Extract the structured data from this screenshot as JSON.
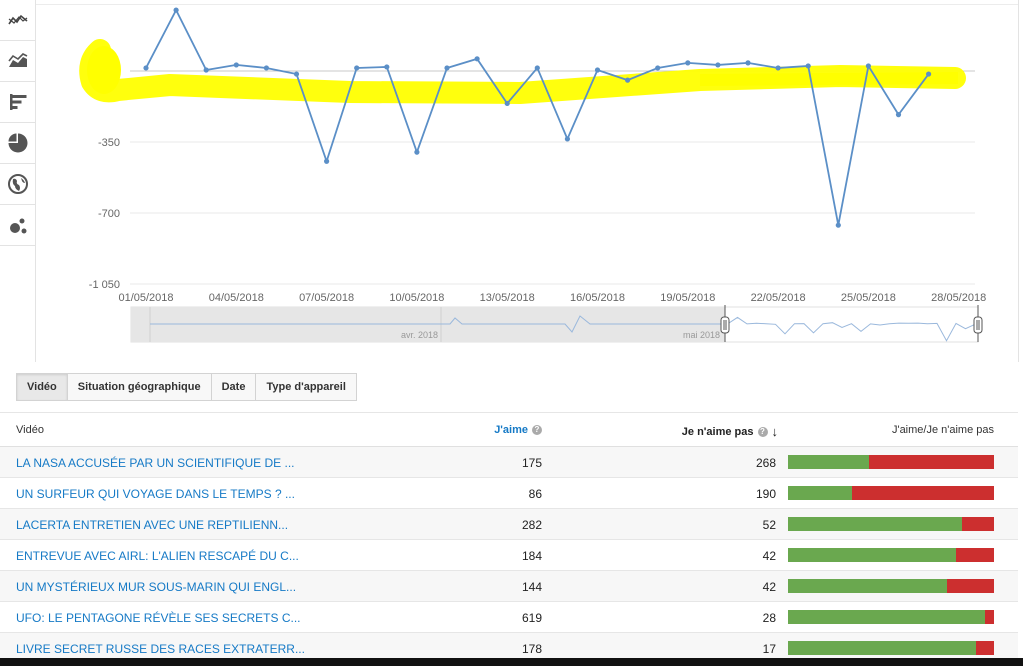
{
  "toolbar": {
    "icons": [
      "line-chart-icon",
      "stacked-area-icon",
      "bar-chart-icon",
      "pie-chart-icon",
      "globe-icon",
      "bubble-chart-icon"
    ]
  },
  "chart_data": {
    "type": "line",
    "x": [
      "01/05/2018",
      "02/05/2018",
      "03/05/2018",
      "04/05/2018",
      "05/05/2018",
      "06/05/2018",
      "07/05/2018",
      "08/05/2018",
      "09/05/2018",
      "10/05/2018",
      "11/05/2018",
      "12/05/2018",
      "13/05/2018",
      "14/05/2018",
      "15/05/2018",
      "16/05/2018",
      "17/05/2018",
      "18/05/2018",
      "19/05/2018",
      "20/05/2018",
      "21/05/2018",
      "22/05/2018",
      "23/05/2018",
      "24/05/2018",
      "25/05/2018",
      "26/05/2018",
      "27/05/2018"
    ],
    "series": [
      {
        "values": [
          15,
          300,
          5,
          30,
          15,
          -15,
          -445,
          15,
          20,
          -400,
          15,
          60,
          -160,
          15,
          -335,
          5,
          -45,
          15,
          40,
          30,
          40,
          15,
          25,
          -760,
          25,
          -215,
          -15
        ]
      }
    ],
    "yticks": [
      "0",
      "-350",
      "-700",
      "-1 050"
    ],
    "ytick_values": [
      0,
      -350,
      -700,
      -1050
    ],
    "ylim": [
      -1050,
      300
    ],
    "xticks": [
      "01/05/2018",
      "04/05/2018",
      "07/05/2018",
      "10/05/2018",
      "13/05/2018",
      "16/05/2018",
      "19/05/2018",
      "22/05/2018",
      "25/05/2018",
      "28/05/2018"
    ],
    "navigator_labels": [
      "avr. 2018",
      "mai 2018"
    ],
    "highlight_color": "#ffff00",
    "line_color": "#5b8fc7"
  },
  "tabs": [
    {
      "label": "Vidéo",
      "active": true
    },
    {
      "label": "Situation géographique",
      "active": false
    },
    {
      "label": "Date",
      "active": false
    },
    {
      "label": "Type d'appareil",
      "active": false
    }
  ],
  "table": {
    "headers": {
      "video": "Vidéo",
      "likes": "J'aime",
      "dislikes": "Je n'aime pas",
      "ratio": "J'aime/Je n'aime pas"
    },
    "rows": [
      {
        "title": "LA NASA ACCUSÉE PAR UN SCIENTIFIQUE DE ...",
        "likes": "175",
        "dislikes": "268",
        "like_fraction": 0.395
      },
      {
        "title": "UN SURFEUR QUI VOYAGE DANS LE TEMPS ? ...",
        "likes": "86",
        "dislikes": "190",
        "like_fraction": 0.312
      },
      {
        "title": "LACERTA ENTRETIEN AVEC UNE REPTILIENN...",
        "likes": "282",
        "dislikes": "52",
        "like_fraction": 0.844
      },
      {
        "title": "ENTREVUE AVEC AIRL: L'ALIEN RESCAPÉ DU C...",
        "likes": "184",
        "dislikes": "42",
        "like_fraction": 0.814
      },
      {
        "title": "UN MYSTÉRIEUX MUR SOUS-MARIN QUI ENGL...",
        "likes": "144",
        "dislikes": "42",
        "like_fraction": 0.774
      },
      {
        "title": "UFO: LE PENTAGONE RÉVÈLE SES SECRETS C...",
        "likes": "619",
        "dislikes": "28",
        "like_fraction": 0.957
      },
      {
        "title": "LIVRE SECRET RUSSE DES RACES EXTRATERR...",
        "likes": "178",
        "dislikes": "17",
        "like_fraction": 0.913
      }
    ],
    "colors": {
      "like": "#6aa84f",
      "dislike": "#cc2f2f",
      "link": "#167ac6"
    }
  }
}
